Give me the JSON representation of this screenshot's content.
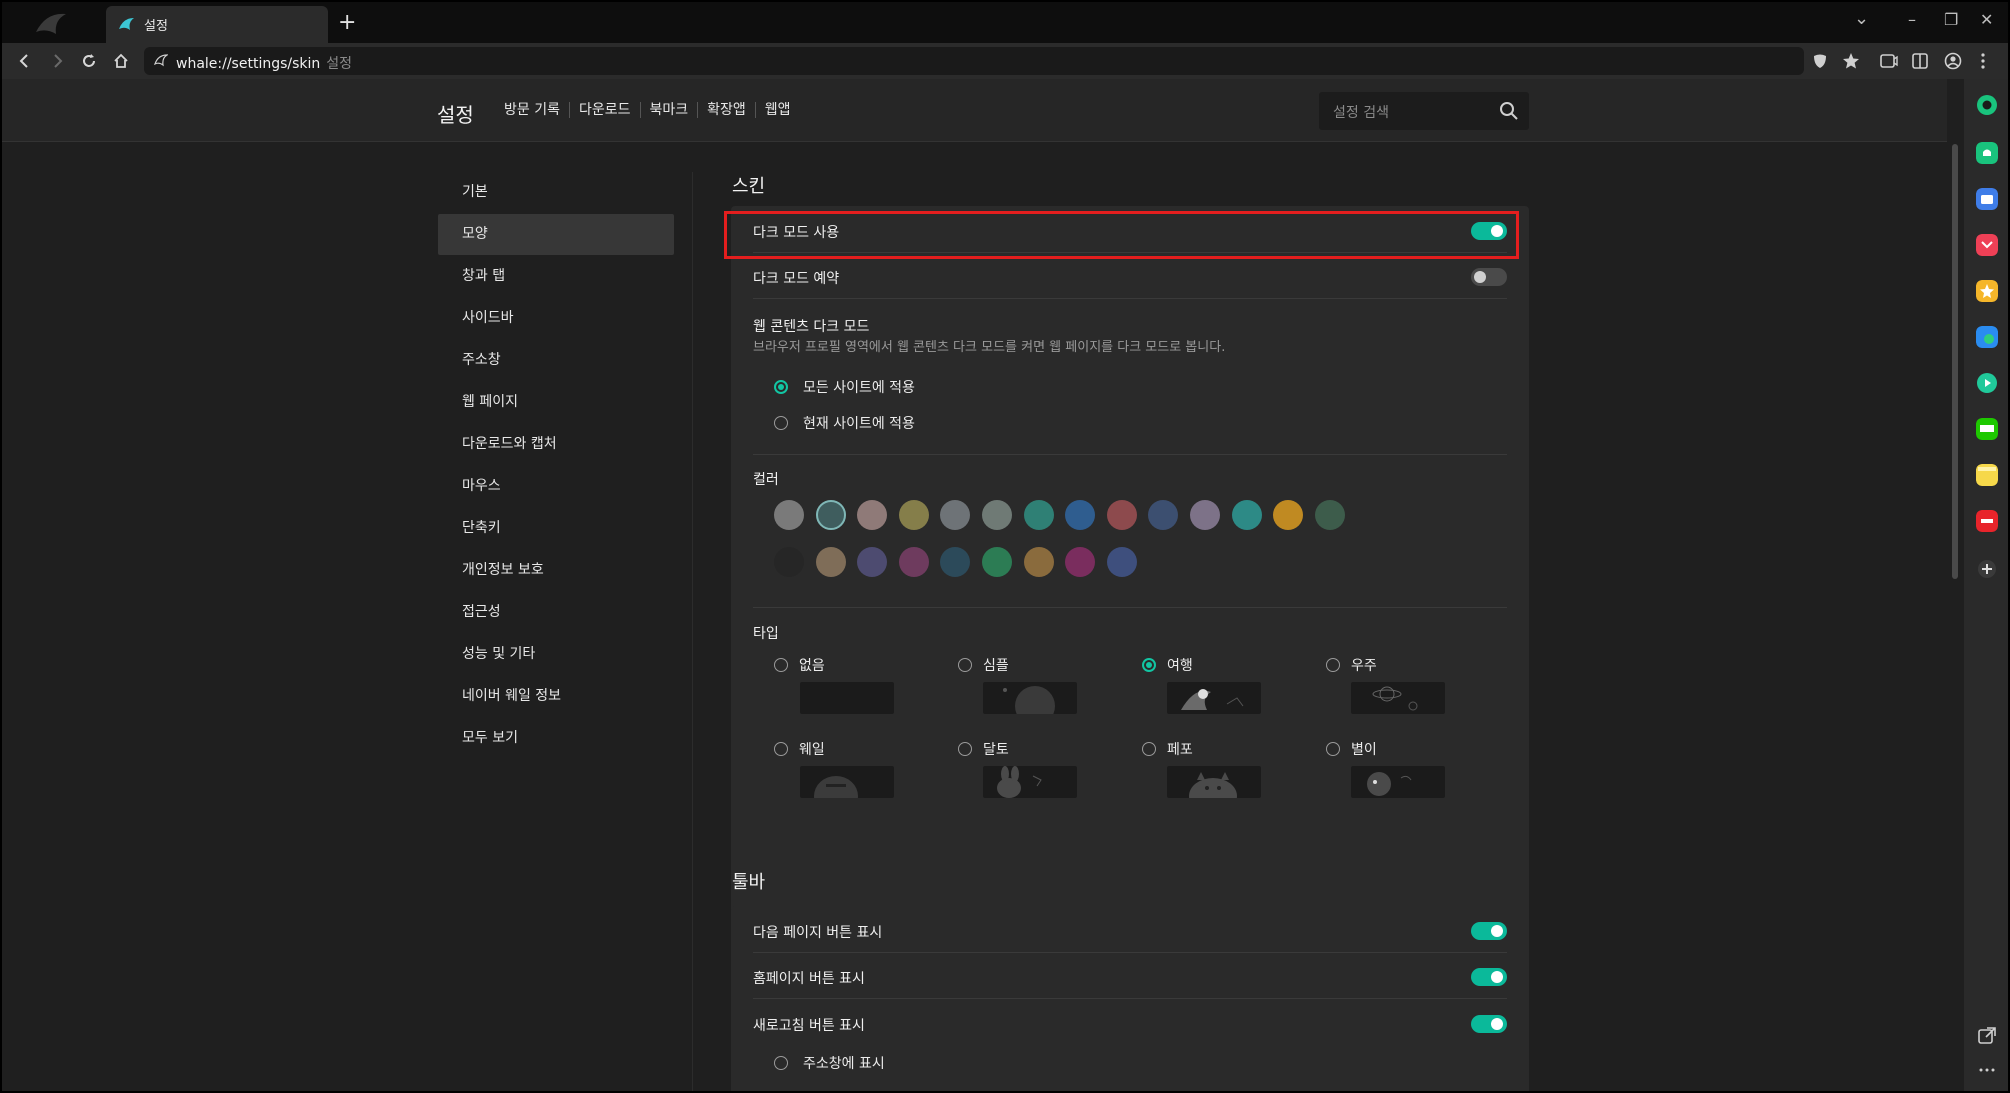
{
  "browser": {
    "tab_title": "설정",
    "new_tab": "+",
    "tab_list_icon": "⌄",
    "minimize": "–",
    "restore": "❐",
    "close": "✕",
    "address_url": "whale://settings/skin",
    "address_title": "설정"
  },
  "header": {
    "title": "설정",
    "nav": [
      "방문 기록",
      "다운로드",
      "북마크",
      "확장앱",
      "웹앱"
    ],
    "search_placeholder": "설정 검색"
  },
  "left_nav": {
    "items": [
      "기본",
      "모양",
      "창과 탭",
      "사이드바",
      "주소창",
      "웹 페이지",
      "다운로드와 캡처",
      "마우스",
      "단축키",
      "개인정보 보호",
      "접근성",
      "성능 및 기타",
      "네이버 웨일 정보",
      "모두 보기"
    ],
    "active_index": 1
  },
  "skin": {
    "title": "스킨",
    "dark_mode_label": "다크 모드 사용",
    "dark_mode_on": true,
    "dark_schedule_label": "다크 모드 예약",
    "dark_schedule_on": false,
    "web_dark_title": "웹 콘텐츠 다크 모드",
    "web_dark_desc": "브라우저 프로필 영역에서 웹 콘텐츠 다크 모드를 켜면 웹 페이지를 다크 모드로 봅니다.",
    "web_dark_options": [
      "모든 사이트에 적용",
      "현재 사이트에 적용"
    ],
    "web_dark_selected": 0,
    "color_title": "컬러",
    "colors_row1": [
      "#7a7a7a",
      "#3f5d5e",
      "#8f7a78",
      "#857e4a",
      "#6e7377",
      "#6f7a75",
      "#2f8075",
      "#2f5d8f",
      "#8d4a4d",
      "#3c4f70",
      "#7d7288",
      "#2d8a86",
      "#c08a22",
      "#3d5c4b"
    ],
    "colors_row2": [
      "#262626",
      "#7f6d58",
      "#4d4b70",
      "#6e3b5e",
      "#2c4a5a",
      "#2c7c54",
      "#8a6b3d",
      "#7a2d5e",
      "#3e4f7d"
    ],
    "selected_color": 1,
    "type_title": "타입",
    "types": [
      "없음",
      "심플",
      "여행",
      "우주",
      "웨일",
      "달토",
      "페포",
      "별이"
    ],
    "selected_type": 2
  },
  "toolbar_section": {
    "title": "툴바",
    "rows": [
      {
        "label": "다음 페이지 버튼 표시",
        "on": true
      },
      {
        "label": "홈페이지 버튼 표시",
        "on": true
      },
      {
        "label": "새로고침 버튼 표시",
        "on": true
      }
    ],
    "sub_option": "주소창에 표시"
  },
  "icons": {
    "back": "back-icon",
    "forward": "forward-icon",
    "reload": "reload-icon",
    "home": "home-icon",
    "search": "search-icon",
    "shield": "shield-icon",
    "star": "star-icon"
  },
  "colors": {
    "accent": "#0bb99a",
    "highlight": "#e41e1e"
  }
}
